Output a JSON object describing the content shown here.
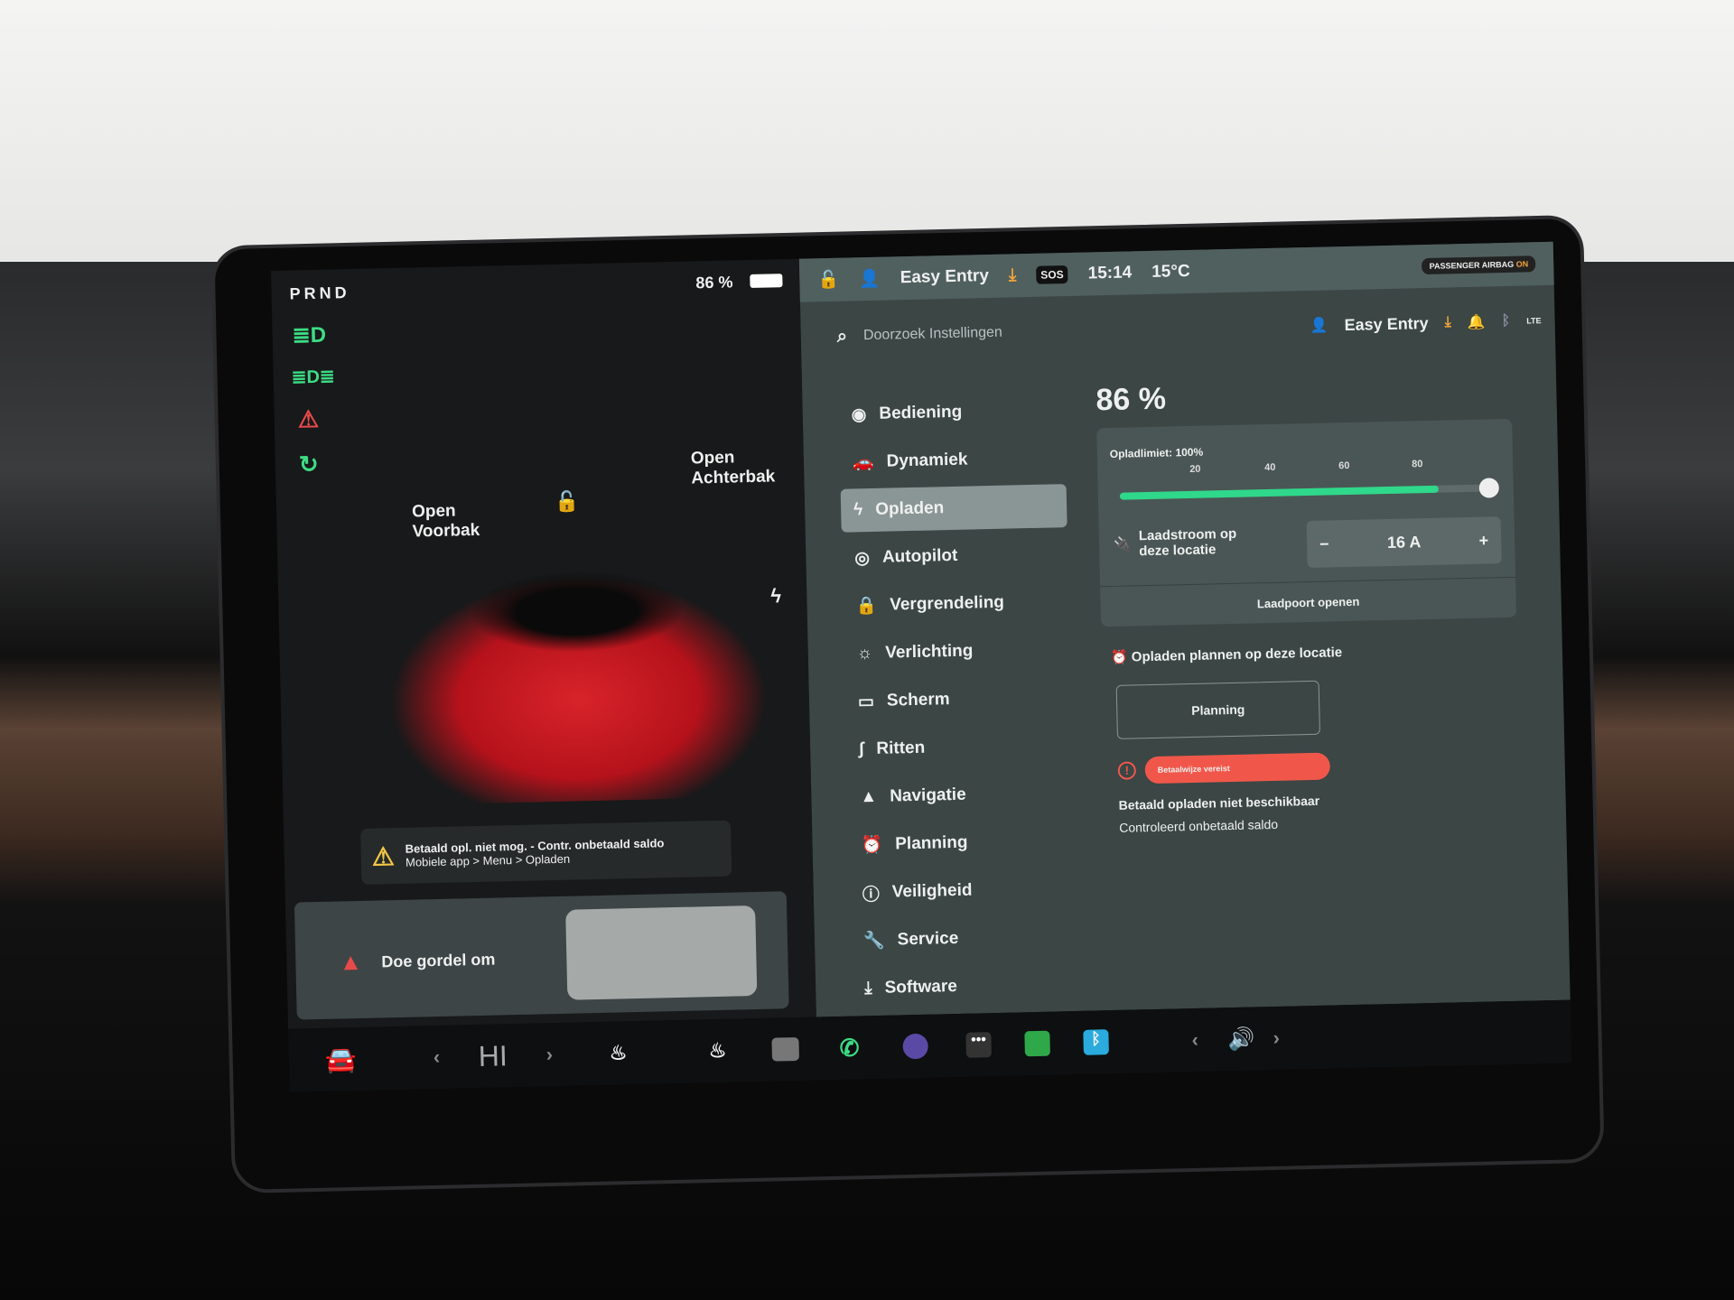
{
  "left": {
    "gear": "PRND",
    "battery": "86 %",
    "frunk_label": "Open\nVoorbak",
    "trunk_label": "Open\nAchterbak",
    "alert": {
      "line1": "Betaald opl. niet mog. - Contr. onbetaald saldo",
      "line2": "Mobiele app > Menu > Opladen"
    },
    "seatbelt": "Doe gordel om",
    "icons": [
      "headlight-icon",
      "fog-light-icon",
      "seatbelt-warning-icon",
      "charging-status-icon"
    ]
  },
  "topbar": {
    "profile": "Easy Entry",
    "sos": "SOS",
    "time": "15:14",
    "temp": "15°C",
    "airbag": "PASSENGER AIRBAG",
    "airbag_state": "ON"
  },
  "settings": {
    "search_placeholder": "Doorzoek Instellingen",
    "profile": "Easy Entry",
    "lte": "LTE",
    "menu": [
      {
        "label": "Bediening",
        "icon": "toggle-icon"
      },
      {
        "label": "Dynamiek",
        "icon": "car-icon"
      },
      {
        "label": "Opladen",
        "icon": "bolt-icon",
        "active": true
      },
      {
        "label": "Autopilot",
        "icon": "steering-wheel-icon"
      },
      {
        "label": "Vergrendeling",
        "icon": "lock-icon"
      },
      {
        "label": "Verlichting",
        "icon": "sun-icon"
      },
      {
        "label": "Scherm",
        "icon": "display-icon"
      },
      {
        "label": "Ritten",
        "icon": "trips-icon"
      },
      {
        "label": "Navigatie",
        "icon": "navigation-icon"
      },
      {
        "label": "Planning",
        "icon": "alarm-icon"
      },
      {
        "label": "Veiligheid",
        "icon": "info-icon"
      },
      {
        "label": "Service",
        "icon": "wrench-icon"
      },
      {
        "label": "Software",
        "icon": "download-icon"
      }
    ]
  },
  "charging": {
    "battery_percent": "86 %",
    "limit_label": "Opladlimiet: 100%",
    "limit_value": 100,
    "charge_level": 86,
    "ticks": [
      "20",
      "40",
      "60",
      "80"
    ],
    "current_label": "Laadstroom op deze locatie",
    "current_value": "16 A",
    "minus": "−",
    "plus": "+",
    "open_port": "Laadpoort openen",
    "schedule_title": "Opladen plannen op deze locatie",
    "planning_button": "Planning",
    "payment_badge": "Betaalwijze vereist",
    "status1": "Betaald opladen niet beschikbaar",
    "status2": "Controleerd onbetaald saldo",
    "accent": "#2fd88a",
    "warning": "#f0574a"
  },
  "bottombar": {
    "climate": "HI",
    "prev": "‹",
    "next": "›"
  }
}
